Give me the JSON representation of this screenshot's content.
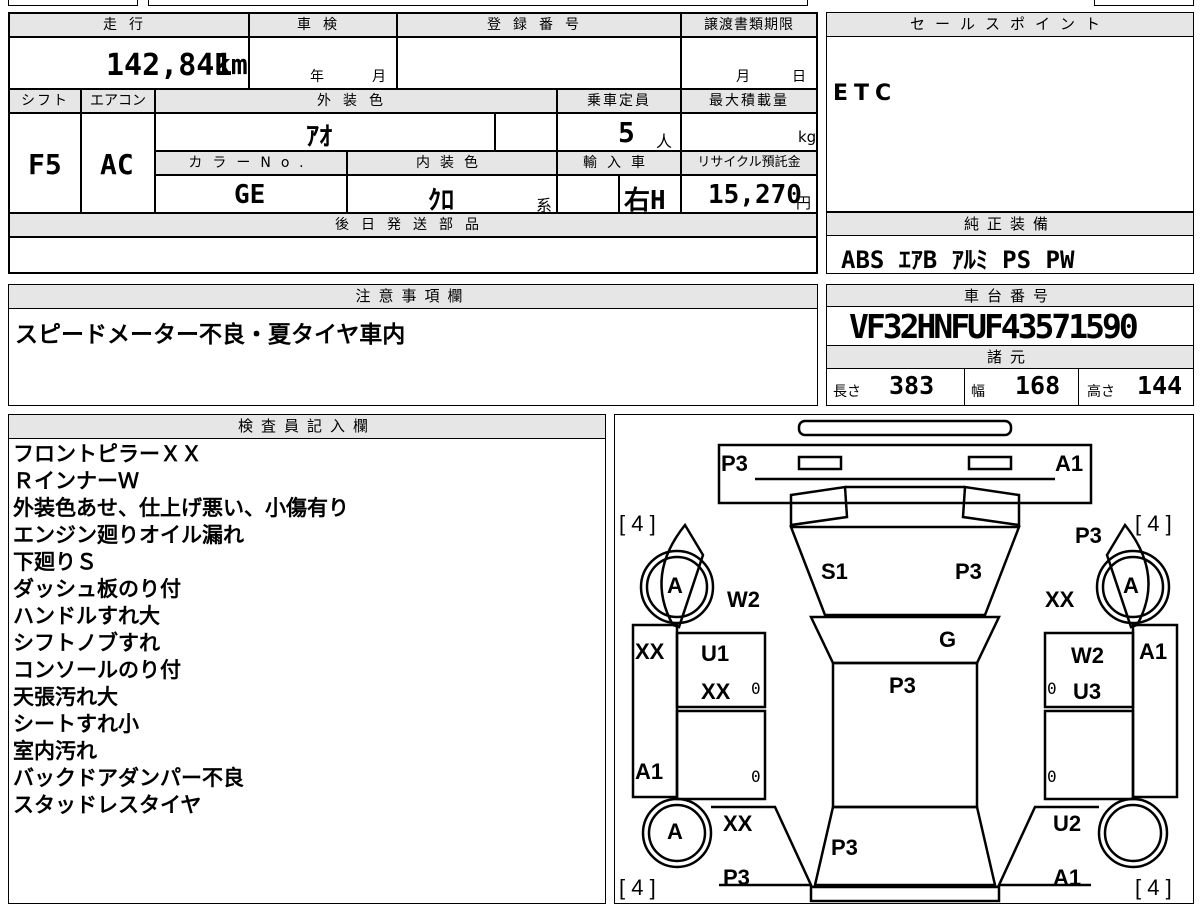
{
  "vehicle": {
    "mileage_label": "走行",
    "mileage": "142,841",
    "mileage_unit": "km",
    "inspection_label": "車検",
    "inspection_year": "年",
    "inspection_month": "月",
    "registration_label": "登録番号",
    "transfer_label": "譲渡書類期限",
    "transfer_month": "月",
    "transfer_day": "日",
    "shift_label": "シフト",
    "shift": "F5",
    "ac_label": "エアコン",
    "ac": "AC",
    "exterior_label": "外装色",
    "exterior": "ｱｵ",
    "capacity_label": "乗車定員",
    "capacity": "5",
    "capacity_unit": "人",
    "max_load_label": "最大積載量",
    "max_load_unit": "kg",
    "color_no_label": "カラーNo.",
    "color_no": "GE",
    "interior_label": "内装色",
    "interior": "ｸﾛ",
    "interior_unit": "系",
    "import_label": "輸入車",
    "import": "右H",
    "recycle_label": "リサイクル預託金",
    "recycle": "15,270",
    "recycle_unit": "円"
  },
  "sales_point": {
    "label": "セールスポイント",
    "text": "ETC"
  },
  "later_parts": {
    "label": "後日発送部品"
  },
  "standard_equipment": {
    "label": "純正装備",
    "text": "ABS ｴｱB ｱﾙﾐ PS PW"
  },
  "notes": {
    "label": "注意事項欄",
    "text": "スピードメーター不良・夏タイヤ車内"
  },
  "chassis": {
    "label": "車台番号",
    "number": "VF32HNFUF43571590"
  },
  "specs": {
    "label": "諸元",
    "length_label": "長さ",
    "length": "383",
    "width_label": "幅",
    "width": "168",
    "height_label": "高さ",
    "height": "144"
  },
  "inspector": {
    "label": "検査員記入欄",
    "lines": [
      "フロントピラーＸＸ",
      "ＲインナーＷ",
      "外装色あせ、仕上げ悪い、小傷有り",
      "エンジン廻りオイル漏れ",
      "下廻りＳ",
      "ダッシュ板のり付",
      "ハンドルすれ大",
      "シフトノブすれ",
      "コンソールのり付",
      "天張汚れ大",
      "シートすれ小",
      "室内汚れ",
      "バックドアダンパー不良",
      "スタッドレスタイヤ"
    ]
  },
  "diagram": {
    "marks": {
      "front_left": "P3",
      "front_right": "A1",
      "tire_fl": "A",
      "tire_fr": "A",
      "tire_rl": "A",
      "hood_left": "S1",
      "hood_right": "P3",
      "fender_fl": "W2",
      "fender_fr": "XX",
      "pillar_fr": "P3",
      "windshield": "G",
      "door_fl_outer": "XX",
      "door_fl_1": "U1",
      "door_fl_2": "XX",
      "roof": "P3",
      "door_fr_1": "W2",
      "door_fr_2": "U3",
      "door_fr_outer": "A1",
      "door_rl_outer": "A1",
      "rear_fl": "XX",
      "rear_fr": "U2",
      "trunk": "P3",
      "rear_left": "P3",
      "rear_right": "A1",
      "zero": "0",
      "bracket_4": "4"
    }
  }
}
